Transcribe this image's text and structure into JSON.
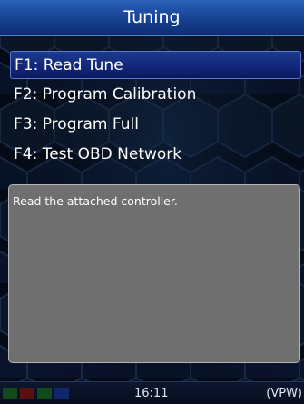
{
  "window": {
    "title": "Tuning"
  },
  "menu": {
    "items": [
      {
        "label": "F1: Read Tune",
        "selected": true
      },
      {
        "label": "F2: Program Calibration",
        "selected": false
      },
      {
        "label": "F3: Program Full",
        "selected": false
      },
      {
        "label": "F4: Test OBD Network",
        "selected": false
      }
    ]
  },
  "description": {
    "text": "Read the attached controller."
  },
  "status": {
    "time": "16:11",
    "mode": "(VPW)",
    "indicators": [
      {
        "name": "indicator-1",
        "color": "#0e4a1a"
      },
      {
        "name": "indicator-2",
        "color": "#5a1010"
      },
      {
        "name": "indicator-3",
        "color": "#0e4a1a"
      },
      {
        "name": "indicator-4",
        "color": "#0f2670"
      }
    ]
  },
  "colors": {
    "title_bar": "#1a4698",
    "selection": "#13287a",
    "panel": "#6f6f6f",
    "background": "#040c18"
  }
}
